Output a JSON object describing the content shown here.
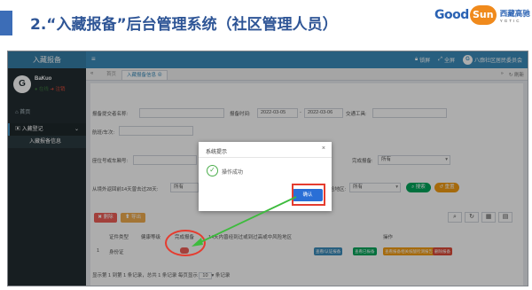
{
  "slide": {
    "title": "2.“入藏报备”后台管理系统（社区管理人员）",
    "logo_good": "Good",
    "logo_sun": "Sun",
    "logo_cn": "西藏高驰",
    "logo_en": "YGTIC",
    "colors": {
      "title": "#2e5596",
      "accent": "#3c6db7",
      "annotation": "#e53c2f",
      "arrow": "#3dbb3d"
    }
  },
  "app": {
    "brand": "入藏报备",
    "menu_icon": "menu-icon",
    "nav": {
      "lock": "锁屏",
      "fullscreen": "全屏",
      "org": "八廓社区居民委员会"
    },
    "user": {
      "avatar_letter": "G",
      "name": "BaKuo",
      "online": "● 在线",
      "logout": "➜ 注销"
    },
    "sidebar": {
      "home": "首页",
      "group": "入藏登记",
      "sub": "入藏报备信息"
    },
    "tabs": {
      "prev": "«",
      "home": "首页",
      "active": "入藏报备信息",
      "next": "»",
      "refresh": "刷新"
    }
  },
  "form": {
    "row1": {
      "name_label": "报备提交者名称:",
      "time_label": "报备时间:",
      "date_from": "2022-03-05",
      "sep": "-",
      "date_to": "2022-03-06",
      "transport_label": "交通工具:"
    },
    "row2": {
      "flight_label": "航班/车次:"
    },
    "row3": {
      "seat_label": "座位号或车厢号:",
      "done_label": "完成报备:",
      "done_value": "所有"
    },
    "row4": {
      "abroad_label": "从境外返回前14天曾去过28天:",
      "abroad_value": "所有",
      "risk_label": "险地区:",
      "risk_value": "所有"
    },
    "search": "搜索",
    "reset": "重置"
  },
  "toolbar": {
    "delete": "删除",
    "export": "导出"
  },
  "table": {
    "headers": [
      "证件类型",
      "健康等级",
      "完成报备",
      "14天内曾经到过或到过高或中风险地区",
      "操作"
    ],
    "row": {
      "index": "1",
      "id_type": "身份证"
    },
    "ops": [
      "查看/认证报备",
      "查看已报备",
      "查看报备相关核酸检测报告",
      "删除报备"
    ]
  },
  "pager": {
    "text": "显示第 1 到第 1 条记录，总共 1 条记录  每页显示",
    "size": "10",
    "unit": "条记录"
  },
  "dialog": {
    "title": "系统提示",
    "close": "×",
    "message": "操作成功",
    "ok": "确认"
  }
}
